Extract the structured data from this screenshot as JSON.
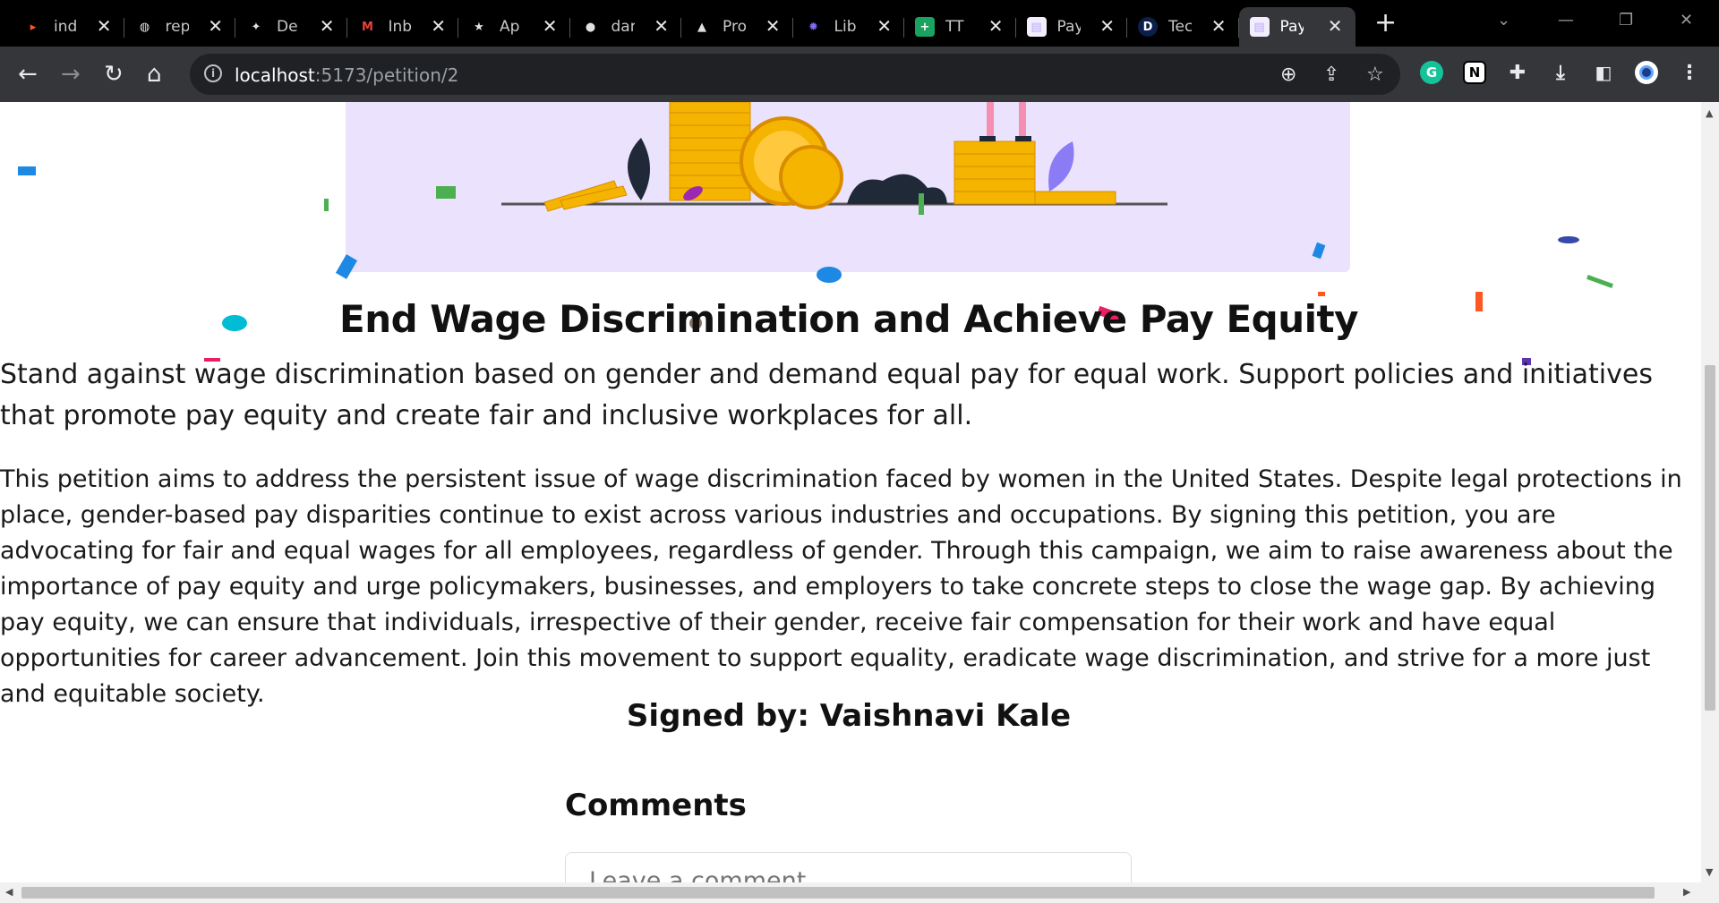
{
  "browser": {
    "tabs": [
      {
        "label": "ind",
        "icon": "bitbucket-orange-icon",
        "color": "#ff5722"
      },
      {
        "label": "rep",
        "icon": "globe-icon",
        "color": "#e0e0e0"
      },
      {
        "label": "De",
        "icon": "bird-icon",
        "color": "#e0e0e0"
      },
      {
        "label": "Inb",
        "icon": "gmail-icon",
        "color": "#ea4335"
      },
      {
        "label": "Ap",
        "icon": "shield-star-icon",
        "color": "#e0e0e0"
      },
      {
        "label": "dar",
        "icon": "github-icon",
        "color": "#e0e0e0"
      },
      {
        "label": "Pro",
        "icon": "triangle-icon",
        "color": "#e0e0e0"
      },
      {
        "label": "Lib",
        "icon": "gear-burst-icon",
        "color": "#7c6cf6"
      },
      {
        "label": "TT",
        "icon": "sheets-plus-icon",
        "color": "#1aa260"
      },
      {
        "label": "Pay",
        "icon": "page-favicon-icon",
        "color": "#b9a7f5"
      },
      {
        "label": "Tec",
        "icon": "d-letter-icon",
        "color": "#1a4fd8"
      },
      {
        "label": "Pay",
        "icon": "page-favicon-icon",
        "color": "#b9a7f5"
      }
    ],
    "active_tab_index": 11,
    "url_host": "localhost",
    "url_path": ":5173/petition/2",
    "extensions": [
      {
        "icon": "grammarly-icon",
        "color": "#15c39a",
        "glyph": "G"
      },
      {
        "icon": "notion-icon",
        "color": "#ffffff",
        "glyph": "N"
      }
    ]
  },
  "petition": {
    "title": "End Wage Discrimination and Achieve Pay Equity",
    "summary": "Stand against wage discrimination based on gender and demand equal pay for equal work. Support policies and initiatives that promote pay equity and create fair and inclusive workplaces for all.",
    "body": "This petition aims to address the persistent issue of wage discrimination faced by women in the United States. Despite legal protections in place, gender-based pay disparities continue to exist across various industries and occupations. By signing this petition, you are advocating for fair and equal wages for all employees, regardless of gender. Through this campaign, we aim to raise awareness about the importance of pay equity and urge policymakers, businesses, and employers to take concrete steps to close the wage gap. By achieving pay equity, we can ensure that individuals, irrespective of their gender, receive fair compensation for their work and have equal opportunities for career advancement. Join this movement to support equality, eradicate wage discrimination, and strive for a more just and equitable society.",
    "signed_by": "Signed by: Vaishnavi Kale"
  },
  "comments": {
    "heading": "Comments",
    "placeholder": "Leave a comment..."
  },
  "colors": {
    "hero_bg": "#ebe3fd",
    "coin_gold": "#f5b400",
    "confetti": [
      "#1e88e5",
      "#4caf50",
      "#e91e63",
      "#00bcd4",
      "#ff5722",
      "#9c27b0",
      "#ffc107"
    ]
  }
}
